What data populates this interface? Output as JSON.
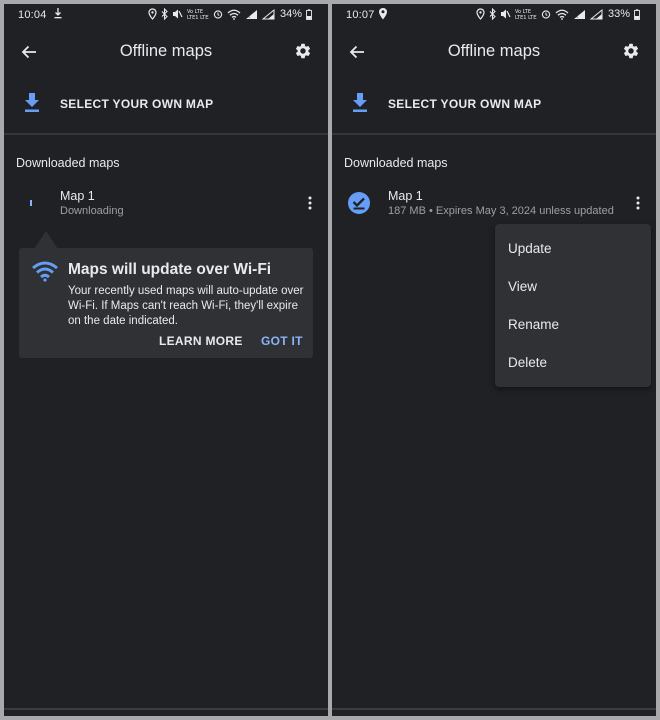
{
  "colors": {
    "background": "#202124",
    "accent_blue": "#8ab4f8",
    "icon_blue": "#669df6",
    "tooltip_bg": "#303134",
    "secondary_text": "#9aa0a6"
  },
  "left": {
    "status": {
      "time": "10:04",
      "battery": "34%"
    },
    "app_bar": {
      "title": "Offline maps",
      "back_icon": "arrow-back-icon",
      "settings_icon": "gear-icon"
    },
    "select_map": {
      "label": "SELECT YOUR OWN MAP",
      "icon": "download-icon"
    },
    "section_header": "Downloaded maps",
    "map": {
      "name": "Map 1",
      "status": "Downloading",
      "icon": "download-progress-icon"
    },
    "tooltip": {
      "icon": "wifi-icon",
      "title": "Maps will update over Wi-Fi",
      "body": "Your recently used maps will auto-update over Wi-Fi. If Maps can't reach Wi-Fi, they'll expire on the date indicated.",
      "learn_more": "LEARN MORE",
      "got_it": "GOT IT"
    }
  },
  "right": {
    "status": {
      "time": "10:07",
      "battery": "33%"
    },
    "app_bar": {
      "title": "Offline maps",
      "back_icon": "arrow-back-icon",
      "settings_icon": "gear-icon"
    },
    "select_map": {
      "label": "SELECT YOUR OWN MAP",
      "icon": "download-icon"
    },
    "section_header": "Downloaded maps",
    "map": {
      "name": "Map 1",
      "status": "187 MB • Expires May 3, 2024 unless updated",
      "icon": "check-circle-icon"
    },
    "menu": {
      "items": [
        {
          "label": "Update"
        },
        {
          "label": "View"
        },
        {
          "label": "Rename"
        },
        {
          "label": "Delete"
        }
      ]
    }
  }
}
